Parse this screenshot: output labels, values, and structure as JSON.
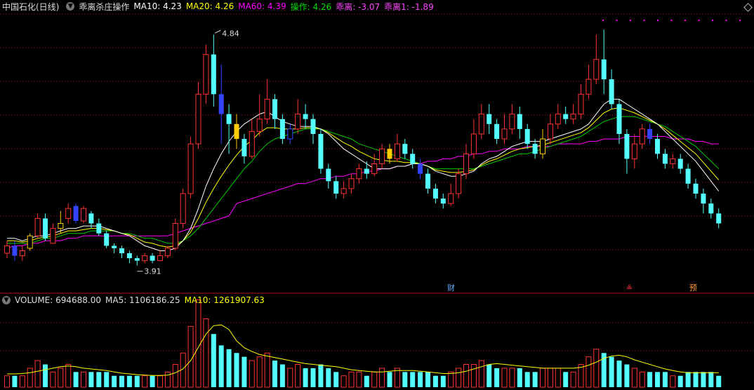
{
  "header": {
    "stock_title": "中国石化(日线)",
    "indicator_name": "乖离杀庄操作",
    "ma10": "MA10: 4.23",
    "ma20": "MA20: 4.26",
    "ma60": "MA60: 4.39",
    "op": "操作: 4.26",
    "bias": "乖离: -3.07",
    "bias1": "乖离1: -1.89"
  },
  "volume_header": {
    "label": "VOLUME: 694688.00",
    "ma5": "MA5: 1106186.25",
    "ma10": "MA10: 1261907.63"
  },
  "markers": {
    "high": "4.84",
    "low": "3.91",
    "cai": "财",
    "zhi": "≗",
    "yu": "预"
  },
  "colors": {
    "up": "#ff3232",
    "down": "#54ffff",
    "ma10": "#ffffff",
    "ma20": "#ffff00",
    "ma60": "#ff00ff",
    "op": "#00cc00",
    "buy_signal": "#ffcc00",
    "sell_signal": "#3344ff"
  },
  "chart_data": {
    "type": "candlestick",
    "price_range": [
      3.85,
      4.9
    ],
    "candles": [
      [
        3.96,
        3.99,
        3.94,
        4.01,
        0.3
      ],
      [
        3.99,
        3.95,
        3.93,
        4.01,
        0.3
      ],
      [
        3.95,
        3.97,
        3.93,
        3.99,
        0.3
      ],
      [
        3.98,
        4.03,
        3.97,
        4.04,
        0.5
      ],
      [
        4.03,
        4.1,
        4.02,
        4.12,
        0.7
      ],
      [
        4.1,
        4.02,
        4.01,
        4.12,
        0.6
      ],
      [
        4.0,
        4.06,
        4.0,
        4.08,
        0.4
      ],
      [
        4.06,
        4.08,
        4.04,
        4.13,
        0.5
      ],
      [
        4.1,
        4.14,
        4.08,
        4.16,
        0.6
      ],
      [
        4.15,
        4.09,
        4.08,
        4.16,
        0.4
      ],
      [
        4.09,
        4.14,
        4.08,
        4.15,
        0.4
      ],
      [
        4.12,
        4.08,
        4.06,
        4.13,
        0.4
      ],
      [
        4.08,
        4.04,
        4.03,
        4.1,
        0.4
      ],
      [
        4.04,
        3.99,
        3.98,
        4.05,
        0.4
      ],
      [
        3.99,
        3.98,
        3.96,
        4.0,
        0.3
      ],
      [
        3.98,
        3.96,
        3.94,
        3.99,
        0.3
      ],
      [
        3.96,
        3.94,
        3.92,
        3.97,
        0.3
      ],
      [
        3.94,
        3.93,
        3.91,
        3.95,
        0.3
      ],
      [
        3.93,
        3.95,
        3.92,
        3.96,
        0.3
      ],
      [
        3.95,
        3.93,
        3.92,
        3.96,
        0.3
      ],
      [
        3.93,
        3.95,
        3.93,
        3.97,
        0.3
      ],
      [
        3.95,
        3.98,
        3.94,
        3.99,
        0.4
      ],
      [
        3.98,
        4.08,
        3.97,
        4.1,
        0.6
      ],
      [
        4.08,
        4.2,
        4.06,
        4.22,
        0.9
      ],
      [
        4.2,
        4.4,
        4.18,
        4.43,
        1.6
      ],
      [
        4.4,
        4.6,
        4.38,
        4.65,
        2.3
      ],
      [
        4.6,
        4.76,
        4.56,
        4.8,
        1.8
      ],
      [
        4.76,
        4.6,
        4.55,
        4.84,
        1.4
      ],
      [
        4.6,
        4.52,
        4.4,
        4.72,
        1.1
      ],
      [
        4.52,
        4.48,
        4.36,
        4.56,
        1.0
      ],
      [
        4.48,
        4.42,
        4.38,
        4.52,
        0.9
      ],
      [
        4.42,
        4.35,
        4.32,
        4.44,
        0.8
      ],
      [
        4.35,
        4.45,
        4.34,
        4.5,
        0.7
      ],
      [
        4.45,
        4.5,
        4.43,
        4.6,
        0.8
      ],
      [
        4.5,
        4.58,
        4.48,
        4.66,
        0.9
      ],
      [
        4.58,
        4.5,
        4.46,
        4.6,
        0.7
      ],
      [
        4.5,
        4.42,
        4.4,
        4.52,
        0.6
      ],
      [
        4.42,
        4.46,
        4.4,
        4.48,
        0.5
      ],
      [
        4.46,
        4.52,
        4.44,
        4.58,
        0.6
      ],
      [
        4.52,
        4.5,
        4.46,
        4.56,
        0.5
      ],
      [
        4.5,
        4.44,
        4.4,
        4.52,
        0.5
      ],
      [
        4.44,
        4.3,
        4.28,
        4.46,
        0.6
      ],
      [
        4.3,
        4.25,
        4.22,
        4.32,
        0.5
      ],
      [
        4.25,
        4.2,
        4.18,
        4.27,
        0.4
      ],
      [
        4.2,
        4.22,
        4.18,
        4.25,
        0.3
      ],
      [
        4.22,
        4.26,
        4.2,
        4.28,
        0.4
      ],
      [
        4.26,
        4.3,
        4.24,
        4.32,
        0.4
      ],
      [
        4.3,
        4.28,
        4.26,
        4.33,
        0.3
      ],
      [
        4.28,
        4.32,
        4.27,
        4.36,
        0.4
      ],
      [
        4.32,
        4.38,
        4.3,
        4.4,
        0.5
      ],
      [
        4.38,
        4.34,
        4.32,
        4.4,
        0.4
      ],
      [
        4.34,
        4.4,
        4.33,
        4.44,
        0.5
      ],
      [
        4.4,
        4.36,
        4.34,
        4.42,
        0.4
      ],
      [
        4.36,
        4.32,
        4.3,
        4.38,
        0.4
      ],
      [
        4.32,
        4.28,
        4.26,
        4.34,
        0.4
      ],
      [
        4.28,
        4.22,
        4.2,
        4.3,
        0.4
      ],
      [
        4.22,
        4.18,
        4.16,
        4.24,
        0.3
      ],
      [
        4.18,
        4.16,
        4.14,
        4.2,
        0.3
      ],
      [
        4.16,
        4.2,
        4.15,
        4.24,
        0.4
      ],
      [
        4.2,
        4.28,
        4.18,
        4.3,
        0.5
      ],
      [
        4.28,
        4.36,
        4.26,
        4.4,
        0.6
      ],
      [
        4.36,
        4.44,
        4.34,
        4.5,
        0.6
      ],
      [
        4.44,
        4.52,
        4.42,
        4.56,
        0.7
      ],
      [
        4.52,
        4.48,
        4.44,
        4.56,
        0.6
      ],
      [
        4.48,
        4.42,
        4.4,
        4.5,
        0.5
      ],
      [
        4.42,
        4.46,
        4.4,
        4.52,
        0.5
      ],
      [
        4.46,
        4.52,
        4.44,
        4.56,
        0.5
      ],
      [
        4.52,
        4.46,
        4.42,
        4.55,
        0.5
      ],
      [
        4.46,
        4.4,
        4.38,
        4.48,
        0.4
      ],
      [
        4.4,
        4.36,
        4.34,
        4.42,
        0.4
      ],
      [
        4.36,
        4.42,
        4.34,
        4.46,
        0.5
      ],
      [
        4.42,
        4.48,
        4.4,
        4.52,
        0.5
      ],
      [
        4.48,
        4.52,
        4.46,
        4.56,
        0.5
      ],
      [
        4.52,
        4.5,
        4.48,
        4.55,
        0.4
      ],
      [
        4.5,
        4.52,
        4.48,
        4.56,
        0.4
      ],
      [
        4.52,
        4.6,
        4.5,
        4.64,
        0.6
      ],
      [
        4.6,
        4.66,
        4.58,
        4.72,
        0.8
      ],
      [
        4.66,
        4.74,
        4.64,
        4.84,
        1.0
      ],
      [
        4.74,
        4.66,
        4.6,
        4.86,
        0.9
      ],
      [
        4.66,
        4.56,
        4.54,
        4.7,
        0.8
      ],
      [
        4.56,
        4.44,
        4.4,
        4.58,
        0.7
      ],
      [
        4.44,
        4.34,
        4.28,
        4.46,
        0.6
      ],
      [
        4.34,
        4.4,
        4.3,
        4.44,
        0.5
      ],
      [
        4.4,
        4.46,
        4.38,
        4.48,
        0.4
      ],
      [
        4.46,
        4.42,
        4.4,
        4.48,
        0.4
      ],
      [
        4.42,
        4.36,
        4.34,
        4.44,
        0.4
      ],
      [
        4.36,
        4.32,
        4.3,
        4.38,
        0.4
      ],
      [
        4.32,
        4.34,
        4.3,
        4.36,
        0.3
      ],
      [
        4.34,
        4.3,
        4.28,
        4.36,
        0.3
      ],
      [
        4.3,
        4.24,
        4.22,
        4.32,
        0.4
      ],
      [
        4.24,
        4.2,
        4.18,
        4.26,
        0.4
      ],
      [
        4.2,
        4.16,
        4.12,
        4.22,
        0.4
      ],
      [
        4.16,
        4.12,
        4.1,
        4.18,
        0.4
      ],
      [
        4.12,
        4.08,
        4.06,
        4.14,
        0.3
      ]
    ],
    "ma10": [
      4.02,
      4.02,
      4.01,
      4.02,
      4.03,
      4.03,
      4.04,
      4.05,
      4.06,
      4.06,
      4.07,
      4.07,
      4.07,
      4.06,
      4.05,
      4.04,
      4.03,
      4.01,
      3.99,
      3.98,
      3.97,
      3.97,
      3.98,
      4.01,
      4.06,
      4.14,
      4.23,
      4.3,
      4.36,
      4.41,
      4.45,
      4.48,
      4.5,
      4.52,
      4.53,
      4.51,
      4.49,
      4.48,
      4.47,
      4.47,
      4.47,
      4.46,
      4.44,
      4.41,
      4.38,
      4.36,
      4.34,
      4.32,
      4.3,
      4.3,
      4.3,
      4.31,
      4.31,
      4.32,
      4.32,
      4.31,
      4.29,
      4.28,
      4.27,
      4.27,
      4.28,
      4.29,
      4.32,
      4.34,
      4.35,
      4.37,
      4.39,
      4.4,
      4.41,
      4.41,
      4.41,
      4.42,
      4.43,
      4.44,
      4.45,
      4.46,
      4.48,
      4.52,
      4.56,
      4.58,
      4.58,
      4.56,
      4.54,
      4.52,
      4.5,
      4.48,
      4.45,
      4.42,
      4.39,
      4.36,
      4.33,
      4.29,
      4.25,
      4.21
    ],
    "ma20": [
      4.0,
      4.0,
      4.0,
      4.0,
      4.01,
      4.02,
      4.02,
      4.03,
      4.04,
      4.04,
      4.04,
      4.05,
      4.05,
      4.05,
      4.05,
      4.04,
      4.04,
      4.03,
      4.02,
      4.02,
      4.01,
      4.0,
      4.0,
      4.01,
      4.03,
      4.06,
      4.1,
      4.14,
      4.18,
      4.22,
      4.26,
      4.3,
      4.33,
      4.37,
      4.4,
      4.42,
      4.43,
      4.44,
      4.45,
      4.46,
      4.46,
      4.46,
      4.45,
      4.44,
      4.43,
      4.42,
      4.4,
      4.39,
      4.38,
      4.37,
      4.36,
      4.35,
      4.34,
      4.33,
      4.32,
      4.31,
      4.3,
      4.3,
      4.3,
      4.3,
      4.3,
      4.3,
      4.31,
      4.32,
      4.33,
      4.34,
      4.35,
      4.36,
      4.36,
      4.37,
      4.38,
      4.39,
      4.4,
      4.41,
      4.42,
      4.43,
      4.45,
      4.47,
      4.49,
      4.5,
      4.51,
      4.51,
      4.51,
      4.5,
      4.49,
      4.48,
      4.47,
      4.45,
      4.43,
      4.41,
      4.39,
      4.36,
      4.33,
      4.3
    ],
    "ma60": [
      3.98,
      3.99,
      3.99,
      4.0,
      4.0,
      4.01,
      4.01,
      4.01,
      4.02,
      4.02,
      4.03,
      4.03,
      4.03,
      4.03,
      4.03,
      4.03,
      4.03,
      4.03,
      4.03,
      4.03,
      4.03,
      4.03,
      4.04,
      4.05,
      4.06,
      4.07,
      4.08,
      4.09,
      4.1,
      4.11,
      4.16,
      4.17,
      4.18,
      4.19,
      4.2,
      4.21,
      4.22,
      4.23,
      4.24,
      4.24,
      4.25,
      4.26,
      4.26,
      4.27,
      4.27,
      4.28,
      4.28,
      4.29,
      4.29,
      4.3,
      4.3,
      4.31,
      4.31,
      4.32,
      4.32,
      4.33,
      4.33,
      4.34,
      4.34,
      4.35,
      4.35,
      4.36,
      4.36,
      4.37,
      4.37,
      4.38,
      4.38,
      4.38,
      4.39,
      4.39,
      4.39,
      4.39,
      4.4,
      4.4,
      4.4,
      4.4,
      4.41,
      4.41,
      4.42,
      4.42,
      4.42,
      4.43,
      4.43,
      4.43,
      4.43,
      4.43,
      4.43,
      4.42,
      4.42,
      4.42,
      4.41,
      4.41,
      4.4,
      4.4
    ],
    "volume_ma5": [
      0.35,
      0.35,
      0.36,
      0.38,
      0.42,
      0.46,
      0.5,
      0.54,
      0.56,
      0.54,
      0.5,
      0.48,
      0.46,
      0.44,
      0.4,
      0.37,
      0.35,
      0.33,
      0.32,
      0.31,
      0.31,
      0.32,
      0.38,
      0.48,
      0.7,
      1.05,
      1.4,
      1.62,
      1.64,
      1.52,
      1.22,
      1.04,
      0.94,
      0.86,
      0.82,
      0.78,
      0.74,
      0.7,
      0.66,
      0.62,
      0.6,
      0.58,
      0.56,
      0.54,
      0.5,
      0.46,
      0.44,
      0.42,
      0.4,
      0.4,
      0.42,
      0.44,
      0.44,
      0.44,
      0.42,
      0.4,
      0.38,
      0.36,
      0.36,
      0.38,
      0.42,
      0.48,
      0.54,
      0.6,
      0.62,
      0.6,
      0.58,
      0.56,
      0.54,
      0.52,
      0.5,
      0.5,
      0.5,
      0.5,
      0.5,
      0.52,
      0.58,
      0.66,
      0.76,
      0.82,
      0.84,
      0.8,
      0.72,
      0.66,
      0.6,
      0.54,
      0.48,
      0.44,
      0.4,
      0.38,
      0.38,
      0.38,
      0.38,
      0.38
    ]
  }
}
